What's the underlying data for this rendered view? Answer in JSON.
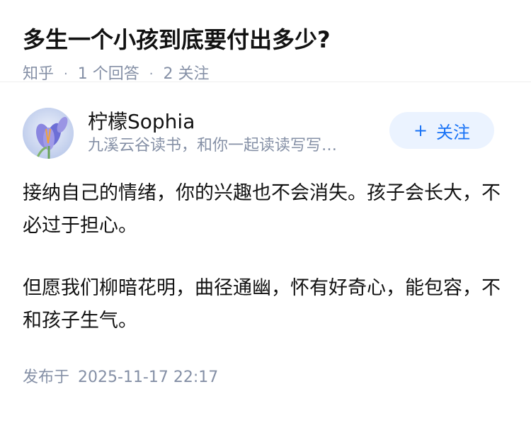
{
  "question": {
    "title": "多生一个小孩到底要付出多少?",
    "source": "知乎",
    "answer_count": "1 个回答",
    "follower_count": "2 关注"
  },
  "answer": {
    "author": {
      "name": "柠檬Sophia",
      "bio": "九溪云谷读书，和你一起读读写写…"
    },
    "follow_button": {
      "icon": "plus-icon",
      "plus": "+",
      "label": "关注"
    },
    "paragraphs": [
      "接纳自己的情绪，你的兴趣也不会消失。孩子会长大，不必过于担心。",
      "但愿我们柳暗花明，曲径通幽，怀有好奇心，能包容，不和孩子生气。"
    ],
    "publish_label": "发布于",
    "publish_time": "2025-11-17 22:17"
  },
  "colors": {
    "meta": "#8590a6",
    "accent": "#1772f6",
    "follow_bg": "#ebf3ff"
  }
}
